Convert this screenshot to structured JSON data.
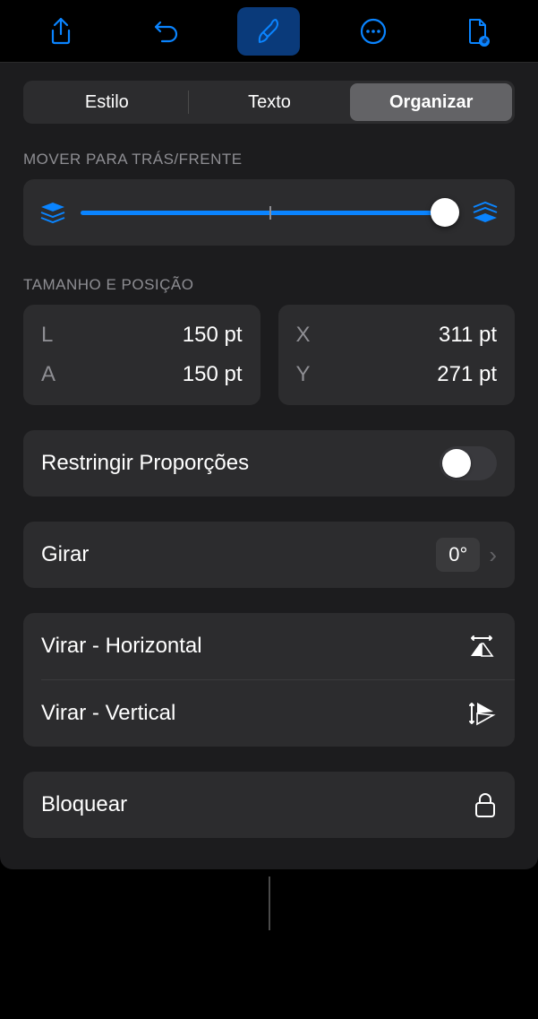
{
  "tabs": {
    "style": "Estilo",
    "text": "Texto",
    "arrange": "Organizar"
  },
  "sections": {
    "layer": "MOVER PARA TRÁS/FRENTE",
    "sizepos": "TAMANHO E POSIÇÃO"
  },
  "size": {
    "w_key": "L",
    "w_val": "150 pt",
    "h_key": "A",
    "h_val": "150 pt"
  },
  "pos": {
    "x_key": "X",
    "x_val": "311 pt",
    "y_key": "Y",
    "y_val": "271 pt"
  },
  "constrain": {
    "label": "Restringir Proporções",
    "on": false
  },
  "rotate": {
    "label": "Girar",
    "value": "0°"
  },
  "flip": {
    "h": "Virar - Horizontal",
    "v": "Virar - Vertical"
  },
  "lock": {
    "label": "Bloquear"
  }
}
